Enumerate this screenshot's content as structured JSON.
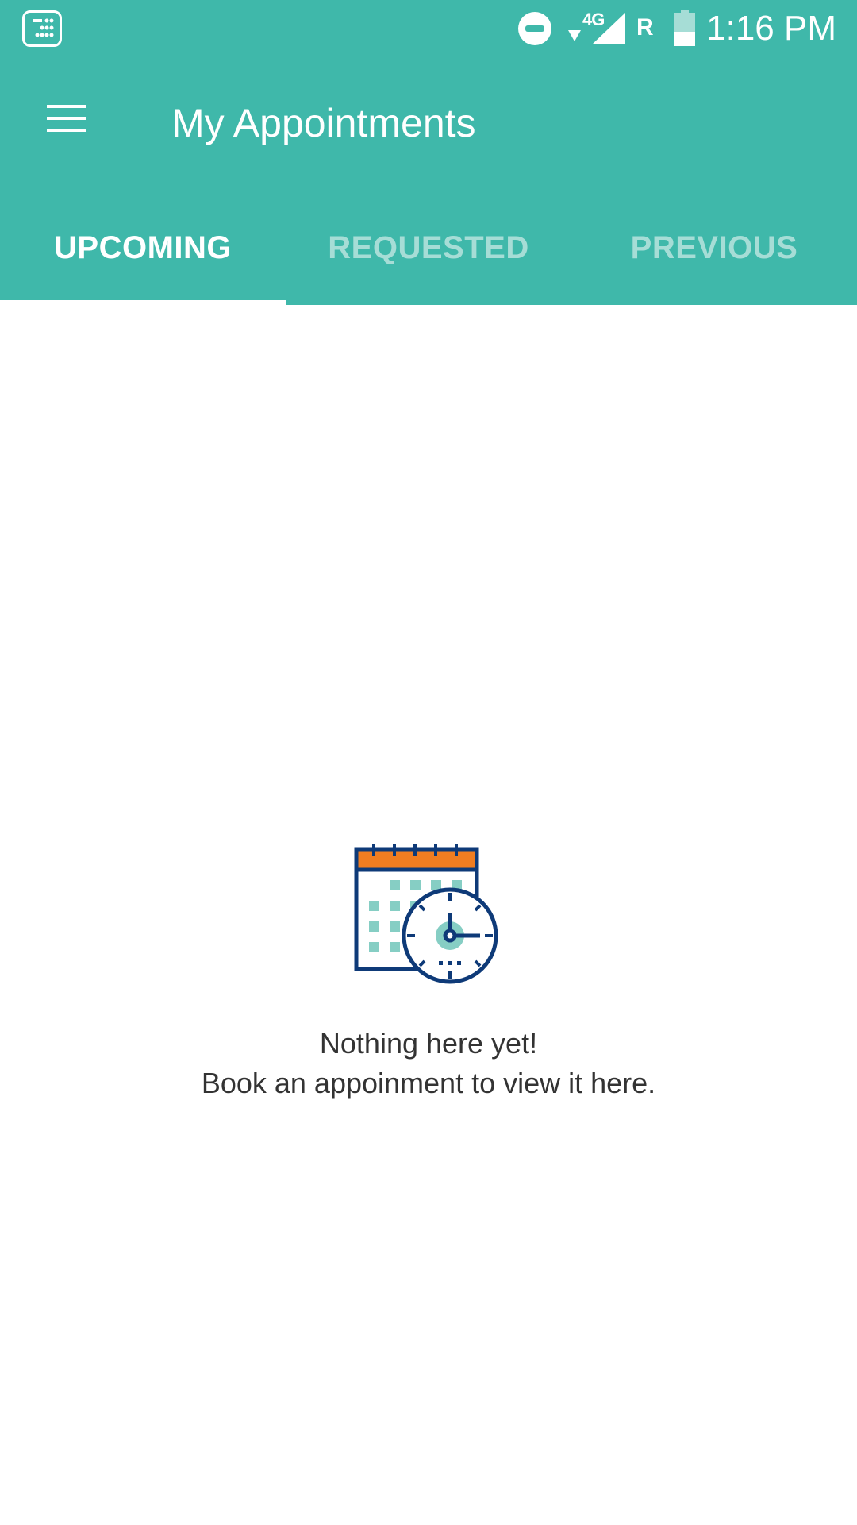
{
  "status_bar": {
    "network_label": "4G",
    "roaming_label": "R",
    "time": "1:16 PM"
  },
  "app_bar": {
    "title": "My Appointments",
    "menu_icon": "hamburger-menu-icon"
  },
  "tabs": [
    {
      "label": "UPCOMING",
      "active": true
    },
    {
      "label": "REQUESTED",
      "active": false
    },
    {
      "label": "PREVIOUS",
      "active": false
    }
  ],
  "empty_state": {
    "icon": "calendar-clock-icon",
    "title": "Nothing here yet!",
    "subtitle": "Book an appoinment to view it here."
  },
  "colors": {
    "primary": "#3fb8aa",
    "tab_inactive": "#a6ddd6",
    "calendar_header": "#f07d21",
    "calendar_outline": "#0e3a78",
    "calendar_dots": "#86cec4",
    "body_text": "#333333"
  }
}
